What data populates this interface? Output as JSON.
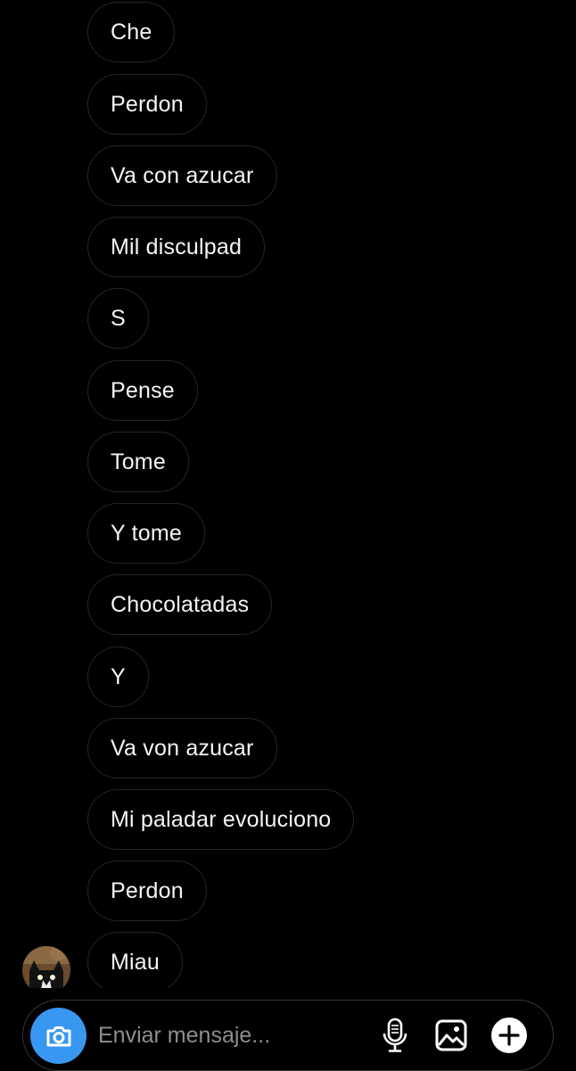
{
  "messages": [
    {
      "text": "Che"
    },
    {
      "text": "Perdon"
    },
    {
      "text": "Va con azucar"
    },
    {
      "text": "Mil disculpad"
    },
    {
      "text": "S"
    },
    {
      "text": "Pense"
    },
    {
      "text": "Tome"
    },
    {
      "text": "Y tome"
    },
    {
      "text": "Chocolatadas"
    },
    {
      "text": "Y"
    },
    {
      "text": "Va von azucar"
    },
    {
      "text": "Mi paladar evoluciono"
    },
    {
      "text": "Perdon"
    },
    {
      "text": "Miau"
    }
  ],
  "sender": {
    "avatar_icon": "cat-avatar"
  },
  "composer": {
    "placeholder": "Enviar mensaje...",
    "camera_icon": "camera-icon",
    "mic_icon": "microphone-icon",
    "gallery_icon": "image-gallery-icon",
    "more_icon": "plus-circle-icon"
  },
  "colors": {
    "background": "#000000",
    "bubble_border": "#262626",
    "accent": "#3897f0",
    "placeholder": "#8e8e8e"
  }
}
